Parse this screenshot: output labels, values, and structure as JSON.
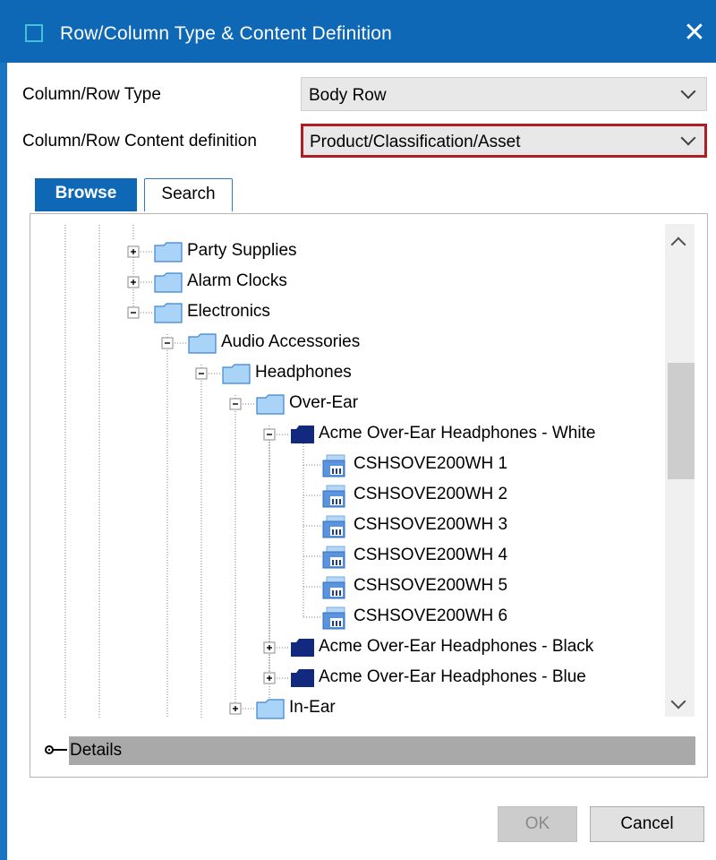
{
  "dialog": {
    "title": "Row/Column Type & Content Definition",
    "close_glyph": "✕"
  },
  "form": {
    "type_label": "Column/Row Type",
    "type_value": "Body Row",
    "content_label": "Column/Row Content definition",
    "content_value": "Product/Classification/Asset"
  },
  "tabs": [
    "Browse",
    "Search"
  ],
  "tree": {
    "nodes": [
      {
        "label": "Party Supplies",
        "kind": "folder",
        "expander": "plus"
      },
      {
        "label": "Alarm Clocks",
        "kind": "folder",
        "expander": "plus"
      },
      {
        "label": "Electronics",
        "kind": "folder",
        "expander": "minus"
      },
      {
        "label": "Audio Accessories",
        "kind": "folder",
        "expander": "minus"
      },
      {
        "label": "Headphones",
        "kind": "folder",
        "expander": "minus"
      },
      {
        "label": "Over-Ear",
        "kind": "folder",
        "expander": "minus"
      },
      {
        "label": "Acme Over-Ear Headphones - White",
        "kind": "product",
        "expander": "minus"
      },
      {
        "label": "CSHSOVE200WH 1",
        "kind": "asset"
      },
      {
        "label": "CSHSOVE200WH 2",
        "kind": "asset"
      },
      {
        "label": "CSHSOVE200WH 3",
        "kind": "asset"
      },
      {
        "label": "CSHSOVE200WH 4",
        "kind": "asset"
      },
      {
        "label": "CSHSOVE200WH 5",
        "kind": "asset"
      },
      {
        "label": "CSHSOVE200WH 6",
        "kind": "asset"
      },
      {
        "label": "Acme Over-Ear Headphones - Black",
        "kind": "product",
        "expander": "plus"
      },
      {
        "label": "Acme Over-Ear Headphones - Blue",
        "kind": "product",
        "expander": "plus"
      },
      {
        "label": "In-Ear",
        "kind": "folder",
        "expander": "plus"
      }
    ]
  },
  "details": {
    "label": "Details"
  },
  "buttons": {
    "ok": "OK",
    "cancel": "Cancel"
  },
  "colors": {
    "title_bar": "#0f68b6",
    "highlight_border": "#ad1f25",
    "folder_fill": "#a9d4f8",
    "product_fill": "#11297e",
    "asset_fill": "#5b93dd"
  },
  "icons": {
    "folder": "folder-icon",
    "product": "product-icon",
    "asset": "asset-icon",
    "expander_plus": "plus-box-icon",
    "expander_minus": "minus-box-icon"
  }
}
